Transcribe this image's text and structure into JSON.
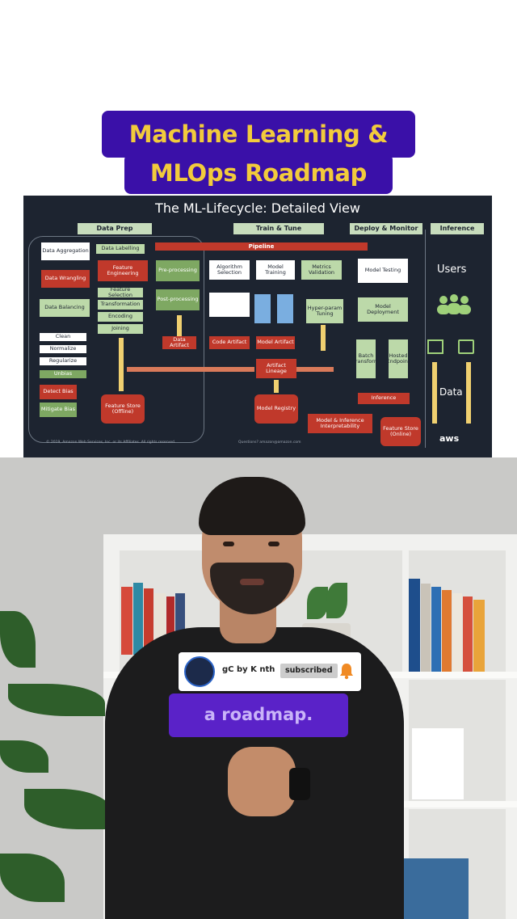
{
  "title": {
    "line1": "Machine Learning &",
    "line2": "MLOps Roadmap"
  },
  "diagram": {
    "heading": "The ML-Lifecycle: Detailed View",
    "sections": {
      "data_prep": "Data Prep",
      "train_tune": "Train & Tune",
      "deploy_monitor": "Deploy & Monitor",
      "inference": "Inference"
    },
    "pipeline": "Pipeline",
    "boxes": {
      "data_aggregation": "Data Aggregation",
      "data_labelling": "Data Labelling",
      "data_wrangling": "Data Wrangling",
      "feature_engineering": "Feature Engineering",
      "pre_processing": "Pre-processing",
      "data_balancing": "Data Balancing",
      "clean": "Clean",
      "normalize": "Normalize",
      "regularize": "Regularize",
      "unbias": "Unbias",
      "detect_bias": "Detect Bias",
      "mitigate_bias": "Mitigate Bias",
      "feature_selection": "Feature Selection",
      "transformation": "Transformation",
      "encoding": "Encoding",
      "joining": "Joining",
      "post_processing": "Post-processing",
      "data_artifact": "Data Artifact",
      "feature_store_offline": "Feature Store (Offline)",
      "algorithm_selection": "Algorithm Selection",
      "model_training": "Model Training",
      "metrics_validation": "Metrics Validation",
      "model_artifact": "Model Artifact",
      "hyperparam_tuning": "Hyper-param Tuning",
      "code_artifact": "Code Artifact",
      "artifact_lineage": "Artifact Lineage",
      "model_registry": "Model Registry",
      "model_inference_interpretability": "Model & Inference Interpretability",
      "model_testing": "Model Testing",
      "model_deployment": "Model Deployment",
      "batch_transform": "Batch Transform",
      "hosted_endpoint": "Hosted Endpoint",
      "inference": "Inference",
      "feature_store_online": "Feature Store (Online)"
    },
    "users_label": "Users",
    "data_label": "Data",
    "aws_label": "aws",
    "footer_copyright": "© 2019, Amazon Web Services, Inc. or its Affiliates. All rights reserved.",
    "footer_question": "Questions? amazon@amazon.com"
  },
  "badge": {
    "channel_name": "gC by K  nth",
    "subscribed_label": "subscribed"
  },
  "caption": "a roadmap.",
  "colors": {
    "pill_bg": "#3a10a8",
    "pill_text": "#f2cb3c",
    "caption_bg": "#5a22c8",
    "diagram_bg": "#1d2430"
  }
}
